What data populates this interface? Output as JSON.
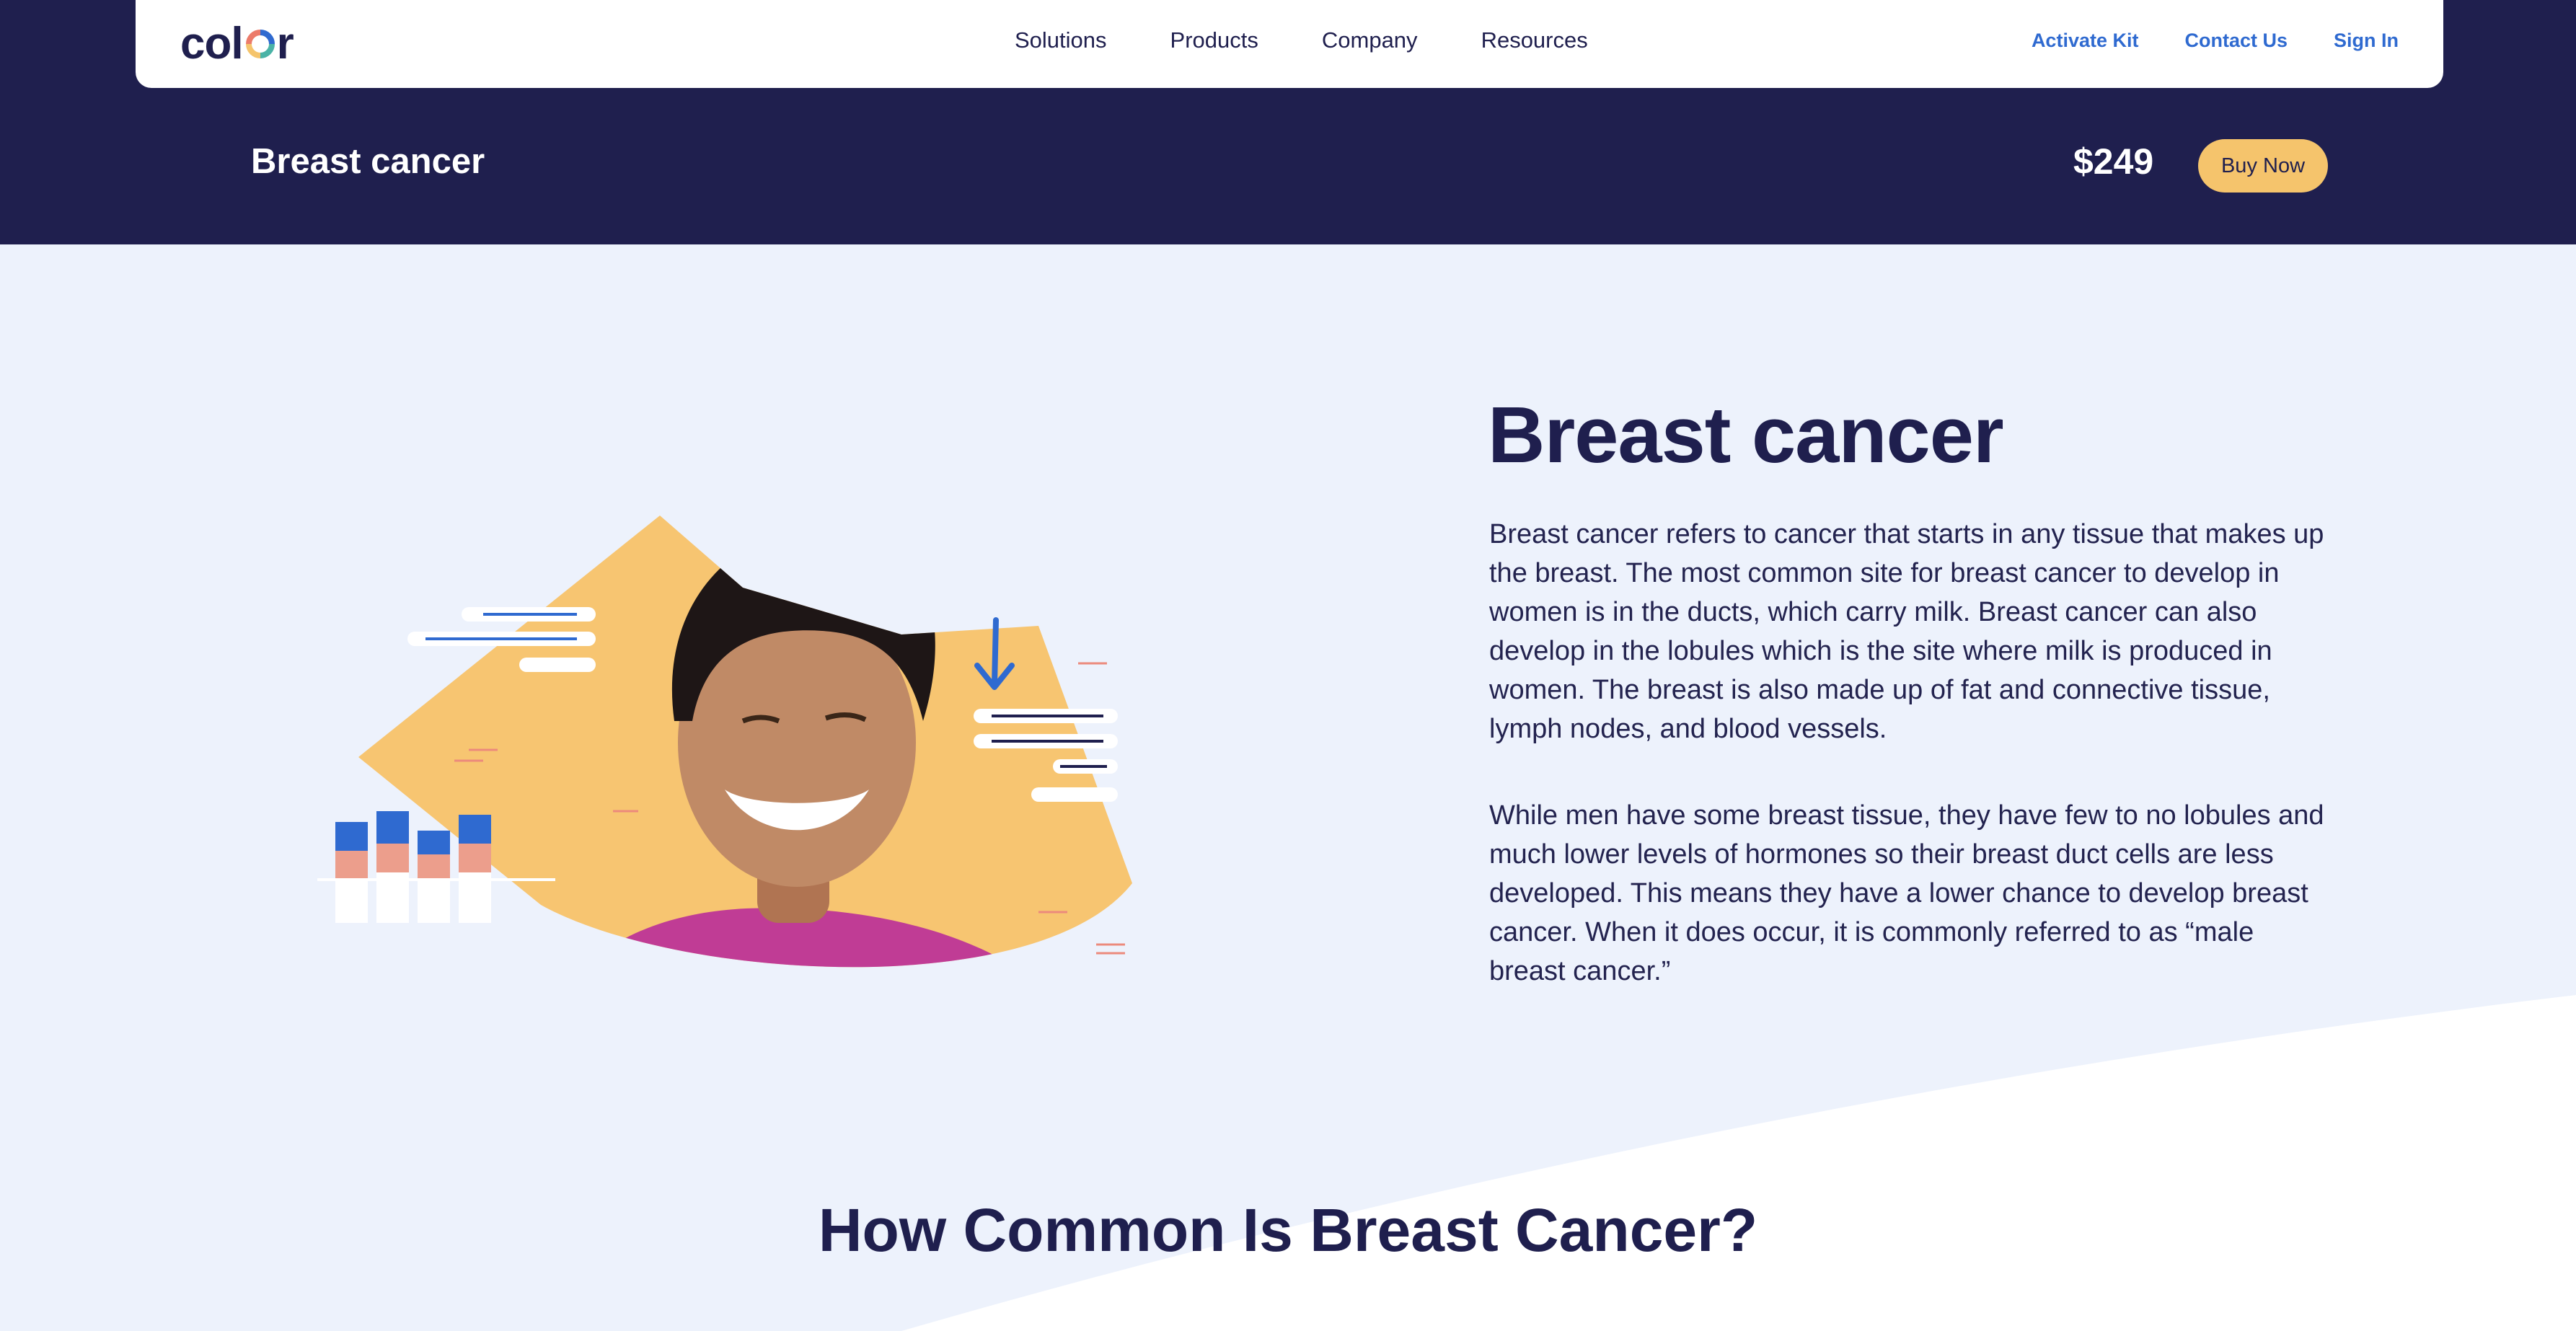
{
  "brand": {
    "logo_text_a": "col",
    "logo_text_b": "r"
  },
  "nav": {
    "links": [
      "Solutions",
      "Products",
      "Company",
      "Resources"
    ],
    "activate_kit": "Activate Kit",
    "contact_us": "Contact Us",
    "sign_in": "Sign In"
  },
  "product_bar": {
    "title": "Breast cancer",
    "price": "$249",
    "buy_label": "Buy Now"
  },
  "hero": {
    "heading": "Breast cancer",
    "paragraphs": [
      "Breast cancer refers to cancer that starts in any tissue that makes up the breast. The most common site for breast cancer to develop in women is in the ducts, which carry milk. Breast cancer can also develop in the lobules which is the site where milk is produced in women. The breast is also made up of fat and connective tissue, lymph nodes, and blood vessels.",
      "While men have some breast tissue, they have few to no lobules and much lower levels of hormones so their breast duct cells are less developed. This means they have a lower chance to develop breast cancer. When it does occur, it is commonly referred to as “male breast cancer.”"
    ]
  },
  "section": {
    "heading": "How Common Is Breast Cancer?"
  },
  "colors": {
    "navy": "#1f1f4e",
    "accent_yellow": "#f5c46c",
    "link_blue": "#2f6ad0",
    "page_bg": "#edf2fc"
  }
}
